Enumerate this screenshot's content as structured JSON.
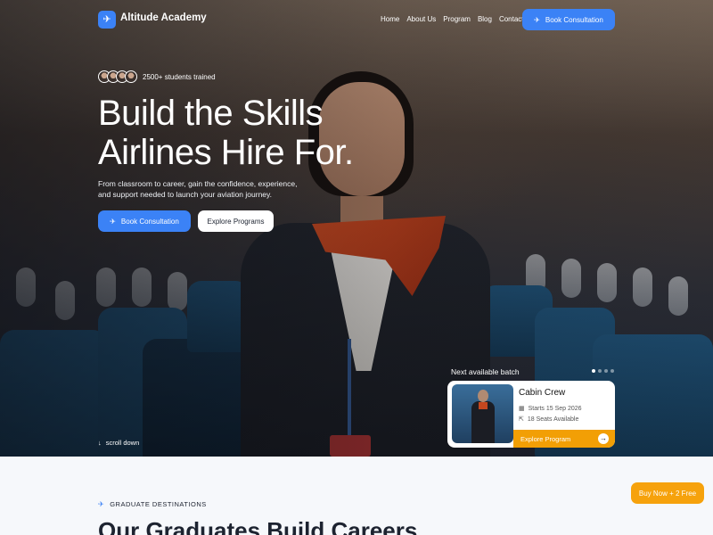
{
  "brand": {
    "name": "Altitude Academy"
  },
  "nav": {
    "links": [
      "Home",
      "About Us",
      "Program",
      "Blog",
      "Contact"
    ],
    "cta_label": "Book Consultation"
  },
  "hero": {
    "students_text": "2500+ students trained",
    "title_line1": "Build the Skills",
    "title_line2": "Airlines Hire For.",
    "description": "From classroom to career, gain the confidence, experience, and support needed to launch your aviation journey.",
    "primary_cta": "Book Consultation",
    "secondary_cta": "Explore Programs",
    "scroll_label": "scroll down"
  },
  "batch": {
    "label": "Next available batch",
    "title": "Cabin Crew",
    "start": "Starts 15 Sep 2026",
    "seats": "18 Seats Available",
    "cta": "Explore Program",
    "slides_total": 4,
    "slide_active": 1
  },
  "section": {
    "tag": "GRADUATE DESTINATIONS",
    "title": "Our Graduates Build Careers"
  },
  "promo": {
    "label": "Buy Now + 2 Free"
  },
  "colors": {
    "primary": "#3b82f6",
    "accent": "#f29f05"
  },
  "icons": [
    "plane-icon",
    "calendar-icon",
    "seat-icon",
    "arrow-right-icon",
    "arrow-down-icon"
  ]
}
